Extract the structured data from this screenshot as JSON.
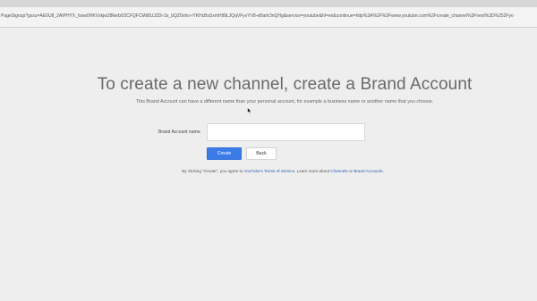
{
  "browser": {
    "url": "PageSignup?gxsu=AE0U8_2AtPHYX_fssw0HKVskjw28lkefz02CFQFCMrBUJZDi-3s_bQZ6nho-rYKHcBsSxmHI8lLJQqVFyvYV8-eBartr3nQHg&service=youtube&hl=en&continue=http%3A%2F%2Fwww.youtube.com%2Fcreate_channel%3Fnext%3D%252Fyo"
  },
  "page": {
    "headline": "To create a new channel, create a Brand Account",
    "subline": "This Brand Account can have a different name than your personal account, for example a business name or another name that you choose.",
    "field_label": "Brand Account name:",
    "field_value": "",
    "field_placeholder": "",
    "create_label": "Create",
    "back_label": "Back",
    "terms": {
      "prefix": "By clicking \"Create\", you agree to ",
      "tos_link": "YouTube's Terms of Service",
      "middle": ". Learn more about ",
      "channels_link": "Channels",
      "or": " or ",
      "brand_link": "Brand Accounts",
      "suffix": "."
    }
  },
  "colors": {
    "background": "#eeeeee",
    "primary_button": "#3b7be8",
    "link": "#2a5db0"
  }
}
